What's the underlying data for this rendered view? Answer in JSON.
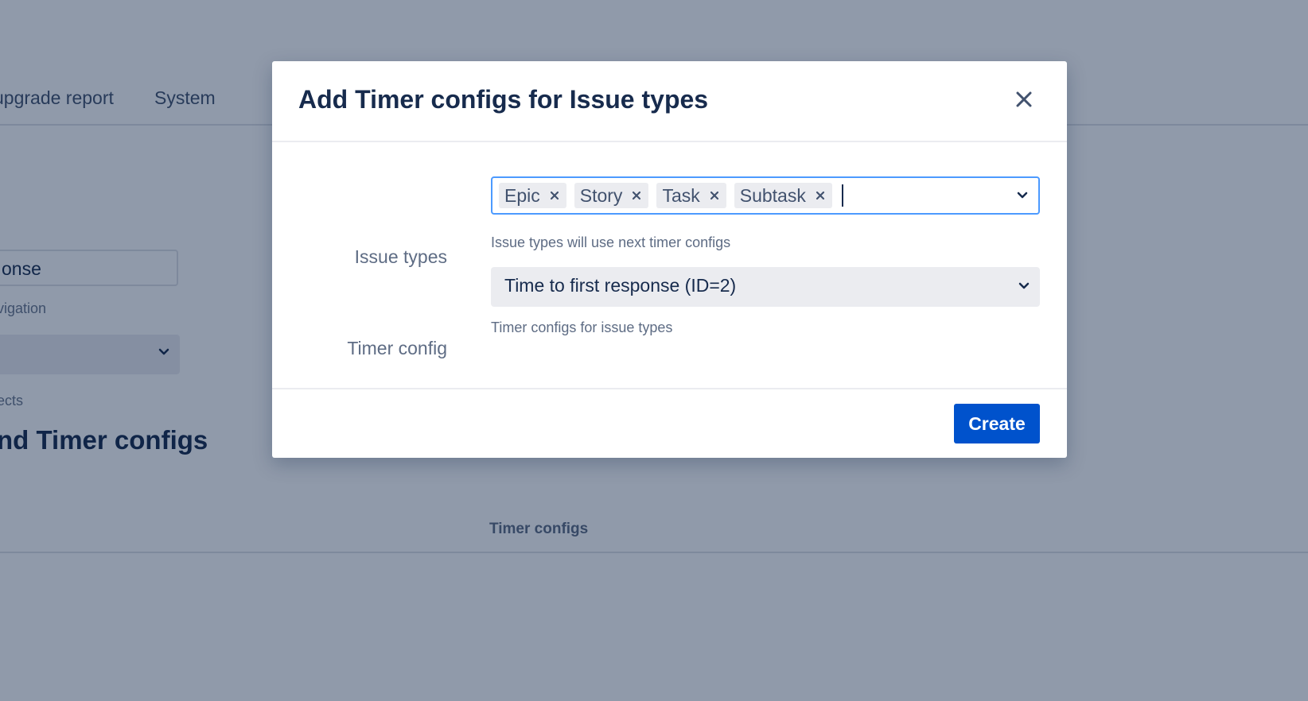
{
  "background": {
    "nav_items": [
      "upgrade report",
      "System"
    ],
    "search_value": "onse",
    "help_navigation": "vigation",
    "help_projects": "ects",
    "heading": "nd Timer configs",
    "table_header": "Timer configs"
  },
  "modal": {
    "title": "Add Timer configs for Issue types",
    "close_icon": "close-icon",
    "issue_types": {
      "label": "Issue types",
      "selected": [
        "Epic",
        "Story",
        "Task",
        "Subtask"
      ],
      "help": "Issue types will use next timer configs"
    },
    "timer_config": {
      "label": "Timer config",
      "value": "Time to first response (ID=2)",
      "help": "Timer configs for issue types"
    },
    "create_label": "Create"
  },
  "colors": {
    "primary": "#0052cc",
    "focus": "#4c9aff",
    "overlay": "rgba(9,30,66,0.45)",
    "text": "#172b4d"
  }
}
